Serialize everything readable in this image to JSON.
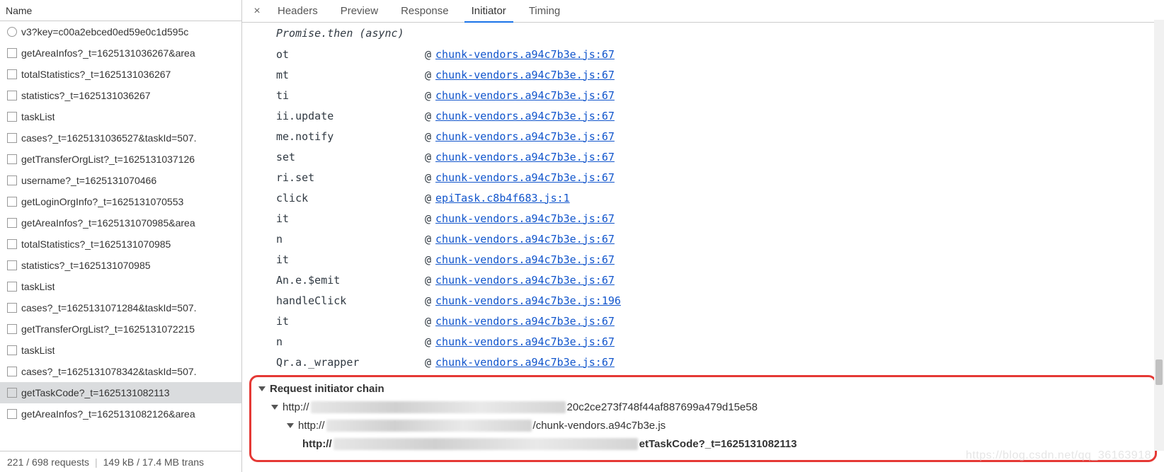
{
  "left": {
    "header": "Name",
    "rows": [
      {
        "name": "v3?key=c00a2ebced0ed59e0c1d595c",
        "icon": "clock",
        "sel": false
      },
      {
        "name": "getAreaInfos?_t=1625131036267&area",
        "icon": "chk",
        "sel": false
      },
      {
        "name": "totalStatistics?_t=1625131036267",
        "icon": "chk",
        "sel": false
      },
      {
        "name": "statistics?_t=1625131036267",
        "icon": "chk",
        "sel": false
      },
      {
        "name": "taskList",
        "icon": "chk",
        "sel": false
      },
      {
        "name": "cases?_t=1625131036527&taskId=507.",
        "icon": "chk",
        "sel": false
      },
      {
        "name": "getTransferOrgList?_t=1625131037126",
        "icon": "chk",
        "sel": false
      },
      {
        "name": "username?_t=1625131070466",
        "icon": "chk",
        "sel": false
      },
      {
        "name": "getLoginOrgInfo?_t=1625131070553",
        "icon": "chk",
        "sel": false
      },
      {
        "name": "getAreaInfos?_t=1625131070985&area",
        "icon": "chk",
        "sel": false
      },
      {
        "name": "totalStatistics?_t=1625131070985",
        "icon": "chk",
        "sel": false
      },
      {
        "name": "statistics?_t=1625131070985",
        "icon": "chk",
        "sel": false
      },
      {
        "name": "taskList",
        "icon": "chk",
        "sel": false
      },
      {
        "name": "cases?_t=1625131071284&taskId=507.",
        "icon": "chk",
        "sel": false
      },
      {
        "name": "getTransferOrgList?_t=1625131072215",
        "icon": "chk",
        "sel": false
      },
      {
        "name": "taskList",
        "icon": "chk",
        "sel": false
      },
      {
        "name": "cases?_t=1625131078342&taskId=507.",
        "icon": "chk",
        "sel": false
      },
      {
        "name": "getTaskCode?_t=1625131082113",
        "icon": "chk",
        "sel": true
      },
      {
        "name": "getAreaInfos?_t=1625131082126&area",
        "icon": "chk",
        "sel": false
      }
    ],
    "footer": {
      "a": "221 / 698 requests",
      "b": "149 kB / 17.4 MB trans"
    }
  },
  "tabs": [
    "Headers",
    "Preview",
    "Response",
    "Initiator",
    "Timing"
  ],
  "activeTab": 3,
  "promise": "Promise.then (async)",
  "stack": [
    {
      "fn": "ot",
      "link": "chunk-vendors.a94c7b3e.js:67"
    },
    {
      "fn": "mt",
      "link": "chunk-vendors.a94c7b3e.js:67"
    },
    {
      "fn": "ti",
      "link": "chunk-vendors.a94c7b3e.js:67"
    },
    {
      "fn": "ii.update",
      "link": "chunk-vendors.a94c7b3e.js:67"
    },
    {
      "fn": "me.notify",
      "link": "chunk-vendors.a94c7b3e.js:67"
    },
    {
      "fn": "set",
      "link": "chunk-vendors.a94c7b3e.js:67"
    },
    {
      "fn": "ri.set",
      "link": "chunk-vendors.a94c7b3e.js:67"
    },
    {
      "fn": "click",
      "link": "epiTask.c8b4f683.js:1"
    },
    {
      "fn": "it",
      "link": "chunk-vendors.a94c7b3e.js:67"
    },
    {
      "fn": "n",
      "link": "chunk-vendors.a94c7b3e.js:67"
    },
    {
      "fn": "it",
      "link": "chunk-vendors.a94c7b3e.js:67"
    },
    {
      "fn": "An.e.$emit",
      "link": "chunk-vendors.a94c7b3e.js:67"
    },
    {
      "fn": "handleClick",
      "link": "chunk-vendors.a94c7b3e.js:196"
    },
    {
      "fn": "it",
      "link": "chunk-vendors.a94c7b3e.js:67"
    },
    {
      "fn": "n",
      "link": "chunk-vendors.a94c7b3e.js:67"
    },
    {
      "fn": "Qr.a._wrapper",
      "link": "chunk-vendors.a94c7b3e.js:67"
    }
  ],
  "chain": {
    "title": "Request initiator chain",
    "r1_pre": "http://",
    "r1_suf": "20c2ce273f748f44af887699a479d15e58",
    "r2_pre": "http://",
    "r2_suf": "/chunk-vendors.a94c7b3e.js",
    "r3_pre": "http://",
    "r3_suf": "etTaskCode?_t=1625131082113"
  },
  "wm": "https://blog.csdn.net/qq_36163918",
  "at": "@"
}
